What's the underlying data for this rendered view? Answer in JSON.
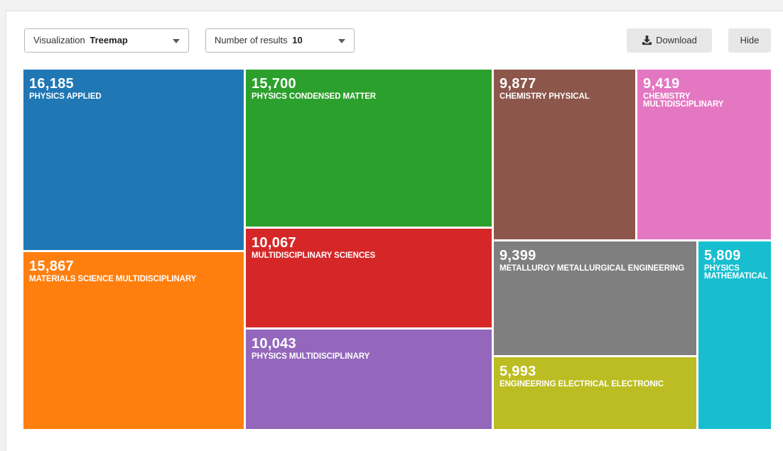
{
  "toolbar": {
    "visualization": {
      "label": "Visualization",
      "value": "Treemap"
    },
    "results": {
      "label": "Number of results",
      "value": "10"
    },
    "download_label": "Download",
    "hide_label": "Hide"
  },
  "chart_data": {
    "type": "treemap",
    "items": [
      {
        "value": "16,185",
        "label": "PHYSICS APPLIED",
        "color": "#1f77b4"
      },
      {
        "value": "15,867",
        "label": "MATERIALS SCIENCE MULTIDISCIPLINARY",
        "color": "#ff7f0e"
      },
      {
        "value": "15,700",
        "label": "PHYSICS CONDENSED MATTER",
        "color": "#2ca02c"
      },
      {
        "value": "10,067",
        "label": "MULTIDISCIPLINARY SCIENCES",
        "color": "#d62728"
      },
      {
        "value": "10,043",
        "label": "PHYSICS MULTIDISCIPLINARY",
        "color": "#9467bd"
      },
      {
        "value": "9,877",
        "label": "CHEMISTRY PHYSICAL",
        "color": "#8c564b"
      },
      {
        "value": "9,419",
        "label": "CHEMISTRY MULTIDISCIPLINARY",
        "color": "#e377c2"
      },
      {
        "value": "9,399",
        "label": "METALLURGY METALLURGICAL ENGINEERING",
        "color": "#7f7f7f"
      },
      {
        "value": "5,993",
        "label": "ENGINEERING ELECTRICAL ELECTRONIC",
        "color": "#bcbd22"
      },
      {
        "value": "5,809",
        "label": "PHYSICS MATHEMATICAL",
        "color": "#17becf"
      }
    ]
  }
}
